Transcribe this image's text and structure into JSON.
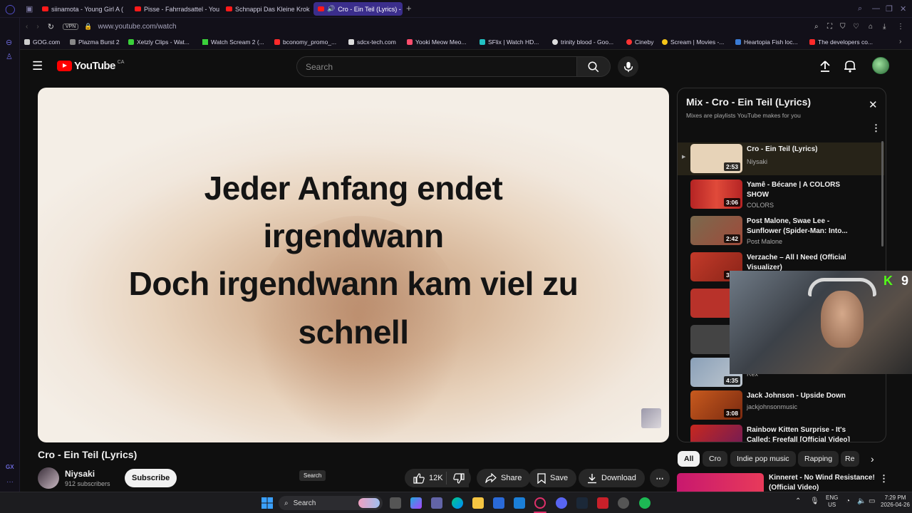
{
  "browser": {
    "tabs": [
      {
        "label": "siinamota - Young Girl A (",
        "active": false
      },
      {
        "label": "Pisse - Fahrradsattel - You",
        "active": false
      },
      {
        "label": "Schnappi Das Kleine Krok",
        "active": false
      },
      {
        "label": "Cro - Ein Teil (Lyrics) -",
        "active": true
      }
    ],
    "new_tab": "+",
    "vpn_badge": "VPN",
    "url": "www.youtube.com/watch",
    "bookmarks": [
      {
        "label": "GOG.com",
        "color": "#cccccc"
      },
      {
        "label": "Plazma Burst 2",
        "color": "#888888"
      },
      {
        "label": "Xetzly Clips - Wat...",
        "color": "#3ad13a"
      },
      {
        "label": "Watch Scream 2 (...",
        "color": "#3ad13a"
      },
      {
        "label": "bconomy_promo_...",
        "color": "#ff2a2a"
      },
      {
        "label": "sdcx-tech.com",
        "color": "#dddddd"
      },
      {
        "label": "Yooki Meow Meo...",
        "color": "#ff4d6d"
      },
      {
        "label": "SFlix | Watch HD...",
        "color": "#22c1c3"
      },
      {
        "label": "trinity blood - Goo...",
        "color": "#dddddd"
      },
      {
        "label": "Cineby",
        "color": "#ff3333"
      },
      {
        "label": "Scream | Movies -...",
        "color": "#f5c518"
      },
      {
        "label": "Heartopia Fish loc...",
        "color": "#3a7bd5"
      },
      {
        "label": "The developers co...",
        "color": "#ff2a2a"
      }
    ]
  },
  "youtube": {
    "logo_text": "YouTube",
    "logo_region": "CA",
    "search_placeholder": "Search",
    "video": {
      "lyrics": [
        "Jeder Anfang endet",
        "irgendwann",
        "Doch irgendwann kam viel zu",
        "schnell"
      ],
      "title": "Cro - Ein Teil (Lyrics)",
      "channel": "Niysaki",
      "subscribers": "912 subscribers",
      "subscribe_label": "Subscribe",
      "likes": "12K",
      "share_label": "Share",
      "save_label": "Save",
      "download_label": "Download",
      "tooltip": "Search"
    },
    "mix": {
      "title": "Mix - Cro - Ein Teil (Lyrics)",
      "subtitle": "Mixes are playlists YouTube makes for you",
      "items": [
        {
          "title": "Cro - Ein Teil (Lyrics)",
          "channel": "Niysaki",
          "duration": "2:53",
          "thumb": "#e7d3b8",
          "playing": true
        },
        {
          "title": "Yamê - Bécane | A COLORS SHOW",
          "channel": "COLORS",
          "duration": "3:06",
          "thumb": "#b52424",
          "playing": false
        },
        {
          "title": "Post Malone, Swae Lee - Sunflower (Spider-Man: Into...",
          "channel": "Post Malone",
          "duration": "2:42",
          "thumb": "#6a5a3e",
          "playing": false
        },
        {
          "title": "Verzache – All I Need (Official Visualizer)",
          "channel": "",
          "duration": "3:25",
          "thumb": "#c43a2a",
          "playing": false
        },
        {
          "title": "",
          "channel": "",
          "duration": "3:",
          "thumb": "#b8322a",
          "playing": false
        },
        {
          "title": "",
          "channel": "",
          "duration": "2",
          "thumb": "#444444",
          "playing": false
        },
        {
          "title": "",
          "channel": "Rex",
          "duration": "4:35",
          "thumb": "#8aa0b8",
          "playing": false
        },
        {
          "title": "Jack Johnson - Upside Down",
          "channel": "jackjohnsonmusic",
          "duration": "3:08",
          "thumb": "#c85a1e",
          "playing": false
        },
        {
          "title": "Rainbow Kitten Surprise - It's Called: Freefall [Official Video]",
          "channel": "",
          "duration": "",
          "thumb": "#c8281e",
          "playing": false
        }
      ]
    },
    "chips": [
      "All",
      "Cro",
      "Indie pop music",
      "Rapping",
      "Re"
    ],
    "up_next": {
      "title": "Kinneret - No Wind Resistance! (Official Video)"
    },
    "overlay": {
      "kick_count": "9"
    }
  },
  "taskbar": {
    "search_label": "Search",
    "lang_line1": "ENG",
    "lang_line2": "US",
    "time": "7:29 PM",
    "date": "2026-04-26"
  }
}
